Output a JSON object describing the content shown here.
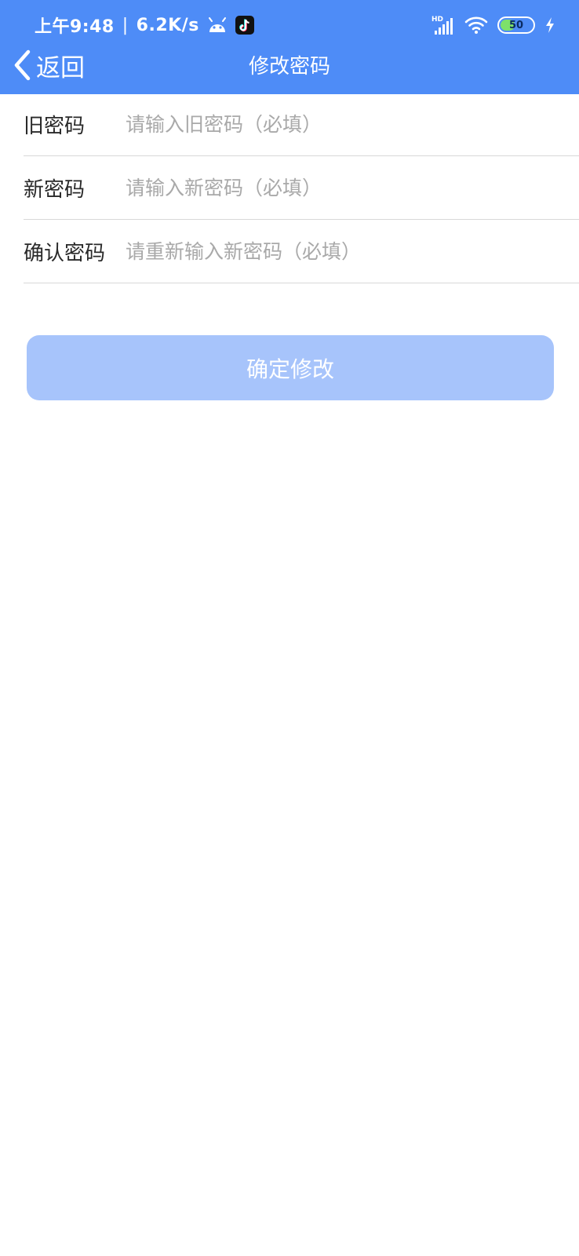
{
  "status_bar": {
    "time": "上午9:48",
    "net_speed": "6.2K/s",
    "signal_label": "HD",
    "battery_level": "50"
  },
  "nav": {
    "back_label": "返回",
    "title": "修改密码"
  },
  "form": {
    "old_password": {
      "label": "旧密码",
      "placeholder": "请输入旧密码（必填）",
      "value": ""
    },
    "new_password": {
      "label": "新密码",
      "placeholder": "请输入新密码（必填）",
      "value": ""
    },
    "confirm_password": {
      "label": "确认密码",
      "placeholder": "请重新输入新密码（必填）",
      "value": ""
    }
  },
  "submit": {
    "label": "确定修改"
  },
  "icons": {
    "status_left": [
      "android-icon",
      "tiktok-icon"
    ],
    "status_right": [
      "hd-signal-icon",
      "wifi-icon",
      "battery-icon",
      "charging-bolt-icon"
    ],
    "nav": [
      "chevron-left-icon"
    ]
  },
  "colors": {
    "header": "#4e8cf7",
    "submit_button": "#a7c4fb",
    "battery_fill": "#7de06a",
    "placeholder": "#a9a9a9",
    "label": "#2a2a2a",
    "divider": "#d8d8d8"
  }
}
